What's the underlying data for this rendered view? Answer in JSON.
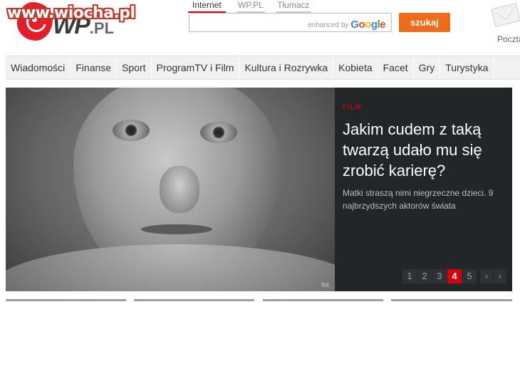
{
  "watermark": "www.wiocha.pl",
  "logo": {
    "brand": "WP",
    "suffix": ".PL"
  },
  "search": {
    "tabs": [
      "Internet",
      "WP.PL",
      "Tłumacz"
    ],
    "active_tab": "Internet",
    "query": "",
    "enhanced_by": "enhanced by",
    "google": [
      "G",
      "o",
      "o",
      "g",
      "l",
      "e"
    ],
    "google_colors": [
      "#4285f4",
      "#ea4335",
      "#fbbc05",
      "#4285f4",
      "#34a853",
      "#ea4335"
    ],
    "button_label": "szukaj"
  },
  "mail": {
    "label": "Poczta"
  },
  "nav": {
    "items": [
      "Wiadomości",
      "Finanse",
      "Sport",
      "ProgramTV i Film",
      "Kultura i Rozrywka",
      "Kobieta",
      "Facet",
      "Gry",
      "Turystyka"
    ]
  },
  "hero": {
    "category": "FILM",
    "title": "Jakim cudem z taką twarzą udało mu się zrobić karierę?",
    "description": "Matki straszą nimi niegrzeczne dzieci. 9 najbrzydszych aktorów świata",
    "photo_credit": "fot.",
    "pages": [
      "1",
      "2",
      "3",
      "4",
      "5"
    ],
    "active_page": "4",
    "prev": "‹",
    "next": "›"
  },
  "colors": {
    "accent": "#d3000e",
    "search_button": "#ef6c1a",
    "panel": "#222629"
  }
}
